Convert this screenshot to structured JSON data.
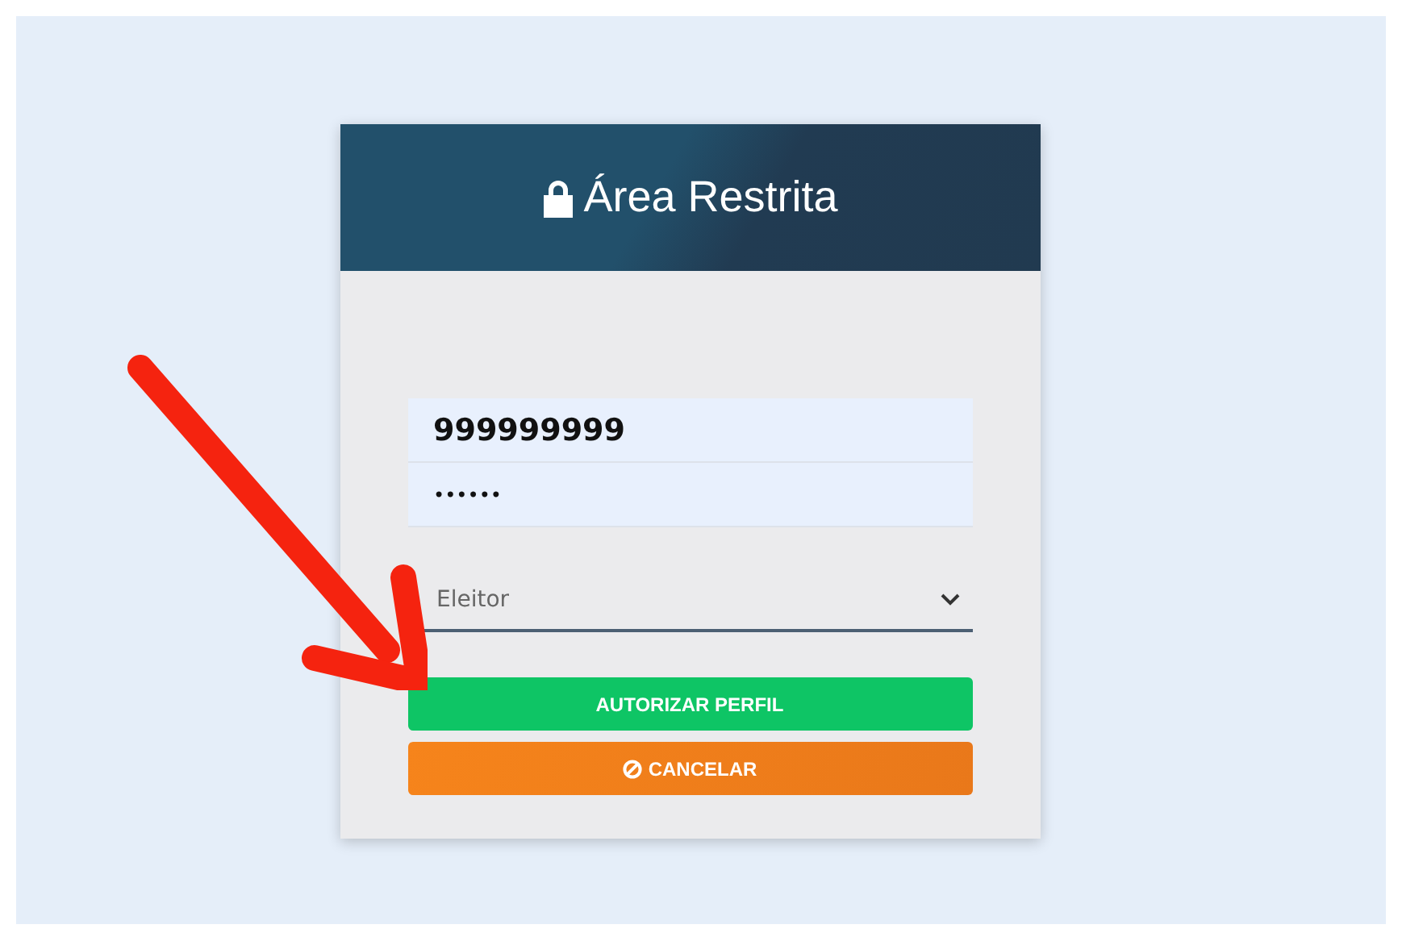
{
  "card": {
    "title": "Área Restrita"
  },
  "fields": [
    {
      "kind": "text",
      "value": "999999999"
    },
    {
      "kind": "password",
      "value": "••••••"
    }
  ],
  "profile_select": {
    "value": "Eleitor"
  },
  "buttons": [
    {
      "kind": "confirm",
      "label": "AUTORIZAR PERFIL"
    },
    {
      "kind": "cancel",
      "label": "CANCELAR"
    }
  ]
}
